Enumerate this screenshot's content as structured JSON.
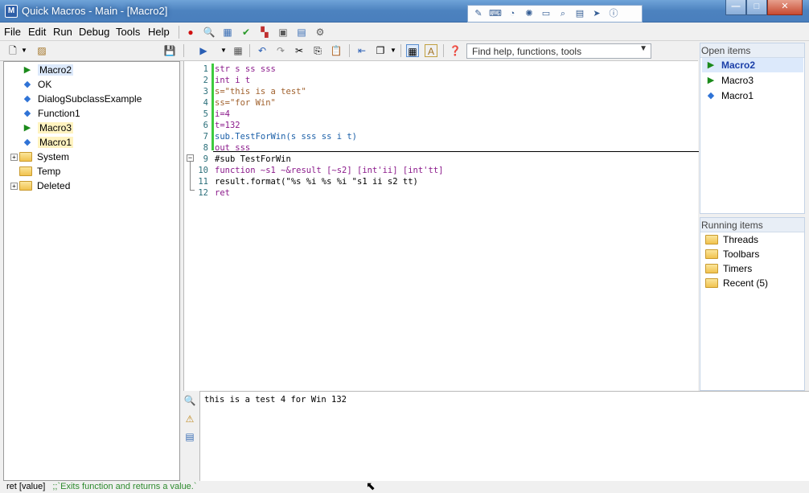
{
  "window": {
    "title": "Quick Macros - Main - [Macro2]",
    "app_icon": "qm-app-icon",
    "buttons": {
      "minimize": "—",
      "maximize": "□",
      "close": "✕"
    }
  },
  "floating_toolbar": {
    "icons": [
      "pen-icon",
      "keyboard-icon",
      "mouse-icon",
      "spinner-icon",
      "window-icon",
      "find-window-icon",
      "dialog-icon",
      "arrows-icon",
      "info-icon"
    ]
  },
  "menu": {
    "items": [
      "File",
      "Edit",
      "Run",
      "Debug",
      "Tools",
      "Help"
    ]
  },
  "search": {
    "placeholder": "Find help, functions, tools"
  },
  "tree": {
    "items": [
      {
        "label": "Macro2",
        "icon": "play-icon",
        "state": "selected"
      },
      {
        "label": "OK",
        "icon": "diamond-icon"
      },
      {
        "label": "DialogSubclassExample",
        "icon": "diamond-icon"
      },
      {
        "label": "Function1",
        "icon": "diamond-icon"
      },
      {
        "label": "Macro3",
        "icon": "play-icon",
        "state": "highlight"
      },
      {
        "label": "Macro1",
        "icon": "diamond-icon",
        "state": "highlight"
      },
      {
        "label": "System",
        "icon": "folder-icon",
        "expander": "+"
      },
      {
        "label": "Temp",
        "icon": "folder-icon"
      },
      {
        "label": "Deleted",
        "icon": "folder-icon",
        "expander": "+"
      }
    ]
  },
  "editor": {
    "lines": [
      {
        "n": "1",
        "text": "str s ss sss"
      },
      {
        "n": "2",
        "text": "int i t"
      },
      {
        "n": "3",
        "text": "s=\"this is a test\""
      },
      {
        "n": "4",
        "text": "ss=\"for Win\""
      },
      {
        "n": "5",
        "text": "i=4"
      },
      {
        "n": "6",
        "text": "t=132"
      },
      {
        "n": "7",
        "text": "sub.TestForWin(s sss ss i t)"
      },
      {
        "n": "8",
        "text": "out sss"
      },
      {
        "n": "9",
        "text": "#sub TestForWin"
      },
      {
        "n": "10",
        "text": "function ~s1 ~&result [~s2] [int'ii] [int'tt]"
      },
      {
        "n": "11",
        "text": "result.format(\"%s %i %s %i \"s1 ii s2 tt)"
      },
      {
        "n": "12",
        "text": "ret"
      }
    ]
  },
  "output": {
    "text": "this is a test 4 for Win 132"
  },
  "open_items": {
    "header": "Open items",
    "items": [
      {
        "label": "Macro2",
        "icon": "play-icon",
        "active": true
      },
      {
        "label": "Macro3",
        "icon": "play-icon"
      },
      {
        "label": "Macro1",
        "icon": "diamond-icon"
      }
    ]
  },
  "running_items": {
    "header": "Running items",
    "items": [
      {
        "label": "Threads",
        "icon": "folder-icon"
      },
      {
        "label": "Toolbars",
        "icon": "folder-icon"
      },
      {
        "label": "Timers",
        "icon": "folder-icon"
      },
      {
        "label": "Recent (5)",
        "icon": "folder-icon"
      }
    ]
  },
  "status": {
    "syntax": "ret [value]",
    "comment": ";;`Exits function and returns a value.`"
  }
}
